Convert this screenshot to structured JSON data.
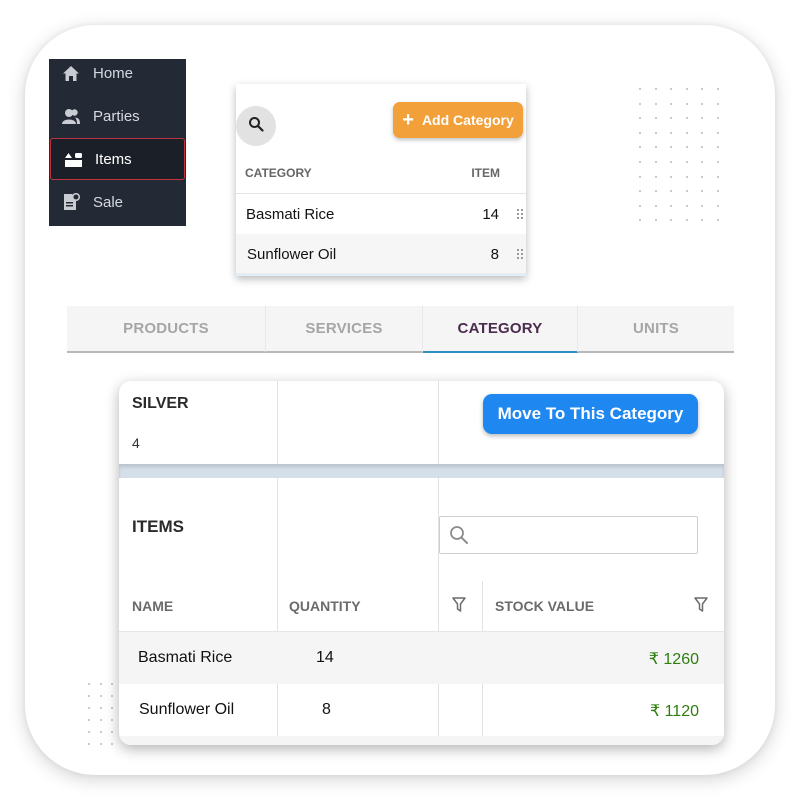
{
  "sidebar": {
    "items": [
      {
        "label": "Home",
        "icon": "home-icon",
        "active": false
      },
      {
        "label": "Parties",
        "icon": "users-icon",
        "active": false
      },
      {
        "label": "Items",
        "icon": "items-icon",
        "active": true
      },
      {
        "label": "Sale",
        "icon": "sale-icon",
        "active": false
      }
    ],
    "active_border_color": "#c0343f"
  },
  "category_card": {
    "search_icon": "search-icon",
    "add_button_label": "Add Category",
    "add_button_icon": "plus-icon",
    "add_button_color": "#f1a03a",
    "columns": [
      "CATEGORY",
      "ITEM"
    ],
    "rows": [
      {
        "name": "Basmati  Rice",
        "count": "14"
      },
      {
        "name": "Sunflower Oil",
        "count": "8"
      }
    ]
  },
  "tabs": [
    {
      "label": "PRODUCTS",
      "active": false
    },
    {
      "label": "SERVICES",
      "active": false
    },
    {
      "label": "CATEGORY",
      "active": true
    },
    {
      "label": "UNITS",
      "active": false
    }
  ],
  "category_detail": {
    "name": "SILVER",
    "item_count": "4",
    "move_button_label": "Move To This Category",
    "move_button_color": "#1e88f0",
    "items_title": "ITEMS",
    "search_placeholder": "",
    "search_value": "",
    "columns": {
      "name": "NAME",
      "quantity": "QUANTITY",
      "stock_value": "STOCK VALUE"
    },
    "rows": [
      {
        "name": "Basmati  Rice",
        "quantity": "14",
        "stock_value": "₹ 1260"
      },
      {
        "name": "Sunflower Oil",
        "quantity": "8",
        "stock_value": "₹ 1120"
      }
    ],
    "value_color": "#2e7d0f"
  }
}
